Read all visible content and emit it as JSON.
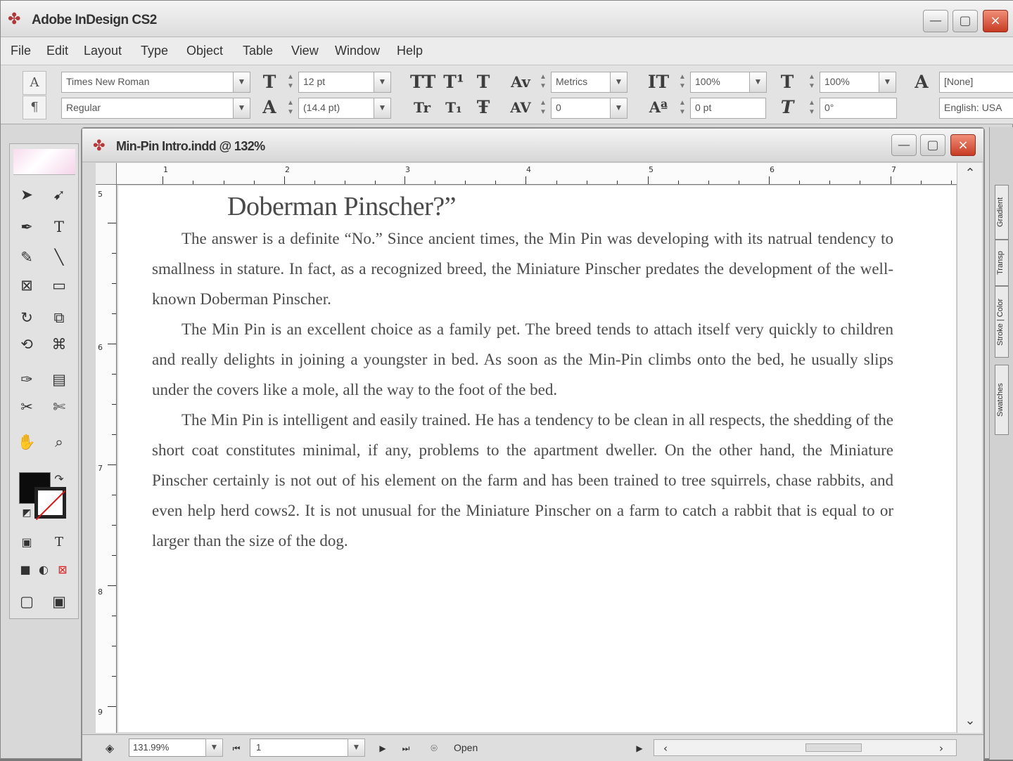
{
  "app": {
    "title": "Adobe InDesign CS2",
    "window_controls": [
      "minimize",
      "maximize",
      "close"
    ]
  },
  "menubar": {
    "items": [
      "File",
      "Edit",
      "Layout",
      "Type",
      "Object",
      "Table",
      "View",
      "Window",
      "Help"
    ]
  },
  "control_panel": {
    "font_family": "Times New Roman",
    "font_style": "Regular",
    "font_size": "12 pt",
    "leading": "(14.4 pt)",
    "kerning": "Metrics",
    "tracking": "0",
    "vertical_scale": "100%",
    "horizontal_scale": "100%",
    "baseline_shift": "0 pt",
    "skew": "0°",
    "character_style": "[None]",
    "language": "English: USA"
  },
  "toolbox": {
    "tools": [
      "selection-tool",
      "direct-selection-tool",
      "pen-tool",
      "type-tool",
      "pencil-tool",
      "line-tool",
      "rectangle-frame-tool",
      "rectangle-tool",
      "rotate-tool",
      "scale-tool",
      "shear-tool",
      "free-transform-tool",
      "eyedropper-tool",
      "gradient-tool",
      "button-tool",
      "scissors-tool",
      "hand-tool",
      "zoom-tool"
    ]
  },
  "document": {
    "title": "Min-Pin Intro.indd @ 132%",
    "heading": "Doberman Pinscher?”",
    "paragraphs": [
      "The answer is a definite “No.” Since ancient times, the Min Pin was developing with its natrual tendency to smallness in stature. In fact, as a recognized breed, the Miniature Pinscher predates the development of the well-known Doberman Pinscher.",
      "The Min Pin is an excellent choice as a family pet. The breed tends to attach itself very quickly to children and really delights in joining a youngster in bed. As soon as the Min-Pin climbs onto the bed, he usually slips under the covers like a mole, all the way to the foot of the bed.",
      "The Min Pin is intelligent and easily trained. He has a tendency to be clean in all respects, the shedding of the short coat constitutes minimal, if any, problems to the apartment dweller. On the other hand, the Miniature Pinscher certainly is not out of his element on the farm and has been trained to tree squirrels, chase rabbits, and even help herd cows2. It is not unusual for the Miniature Pinscher on a farm to catch a rabbit that is equal to or larger than the size of the dog."
    ],
    "ruler_marks": [
      "1",
      "2",
      "3",
      "4",
      "5",
      "6",
      "7"
    ],
    "vertical_ruler_marks": [
      "5",
      "6",
      "7",
      "8",
      "9"
    ]
  },
  "statusbar": {
    "zoom": "131.99%",
    "page": "1",
    "status": "Open"
  },
  "right_panel": {
    "tabs": [
      "Gradient",
      "Transp",
      "Stroke | Color",
      "Swatches"
    ]
  }
}
